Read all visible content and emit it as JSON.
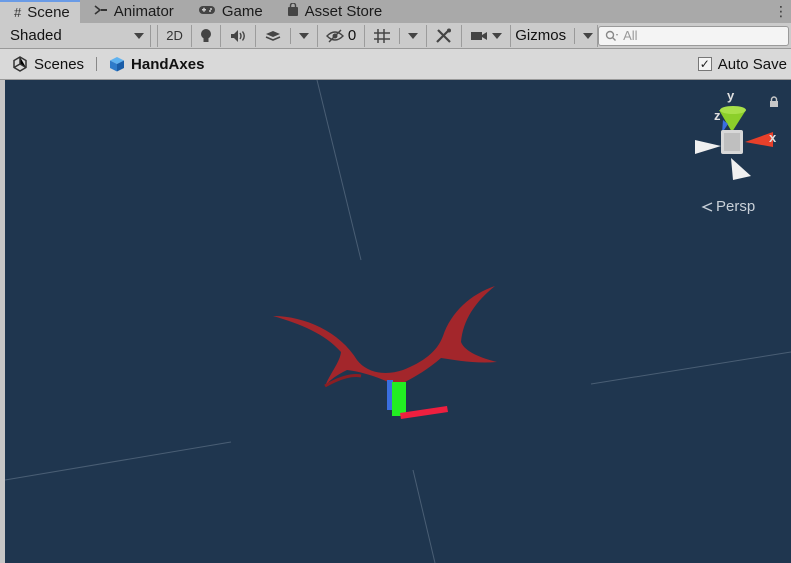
{
  "tabs": [
    {
      "label": "Scene",
      "icon": "grid-icon",
      "active": true
    },
    {
      "label": "Animator",
      "icon": "animator-icon",
      "active": false
    },
    {
      "label": "Game",
      "icon": "gamepad-icon",
      "active": false
    },
    {
      "label": "Asset Store",
      "icon": "shopping-bag-icon",
      "active": false
    }
  ],
  "toolbar": {
    "shading_mode": "Shaded",
    "mode_2d": "2D",
    "hidden_count": "0",
    "gizmos_label": "Gizmos",
    "search_placeholder": "All"
  },
  "breadcrumb": {
    "scenes_label": "Scenes",
    "object_label": "HandAxes"
  },
  "autosave": {
    "label": "Auto Save",
    "checked": true
  },
  "viewport": {
    "background": "#1f364f",
    "projection_label": "Persp",
    "gizmo_axes": {
      "x": "x",
      "y": "y",
      "z": "z"
    },
    "colors": {
      "x_axis": "#e8402a",
      "y_axis": "#8ccf2a",
      "z_axis": "#3a6ee0",
      "object": "#a3262b"
    }
  }
}
